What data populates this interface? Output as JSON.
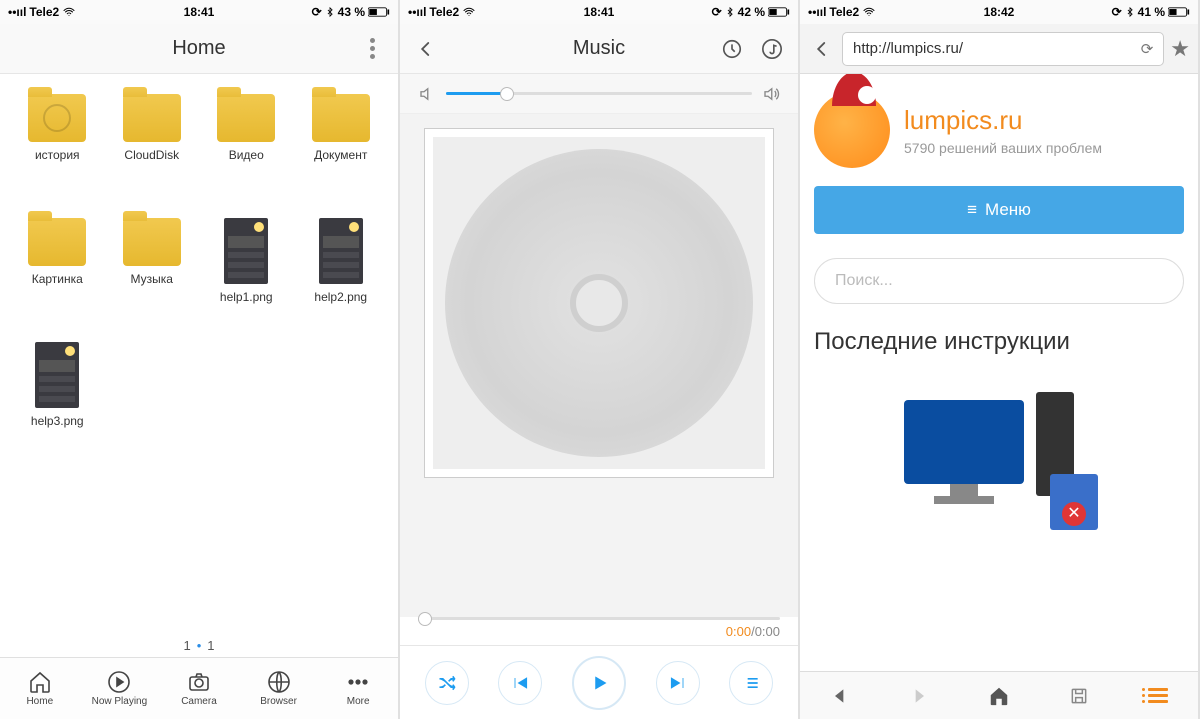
{
  "status": {
    "carrier": "Tele2",
    "time1": "18:41",
    "time2": "18:41",
    "time3": "18:42",
    "battery1": "43 %",
    "battery2": "42 %",
    "battery3": "41 %"
  },
  "home": {
    "title": "Home",
    "folders": [
      {
        "label": "история",
        "type": "history"
      },
      {
        "label": "CloudDisk",
        "type": "folder"
      },
      {
        "label": "Видео",
        "type": "folder"
      },
      {
        "label": "Документ",
        "type": "folder"
      },
      {
        "label": "Картинка",
        "type": "folder"
      },
      {
        "label": "Музыка",
        "type": "folder"
      },
      {
        "label": "help1.png",
        "type": "thumb"
      },
      {
        "label": "help2.png",
        "type": "thumb"
      },
      {
        "label": "help3.png",
        "type": "thumb"
      }
    ],
    "pager_current": "1",
    "pager_total": "1",
    "tabs": {
      "home": "Home",
      "now": "Now Playing",
      "camera": "Camera",
      "browser": "Browser",
      "more": "More"
    }
  },
  "music": {
    "title": "Music",
    "cur": "0:00",
    "total": "/0:00"
  },
  "browser": {
    "url": "http://lumpics.ru/",
    "site_name": "lumpics.ru",
    "site_sub": "5790 решений ваших проблем",
    "menu": "Меню",
    "search_placeholder": "Поиск...",
    "section": "Последние инструкции"
  }
}
